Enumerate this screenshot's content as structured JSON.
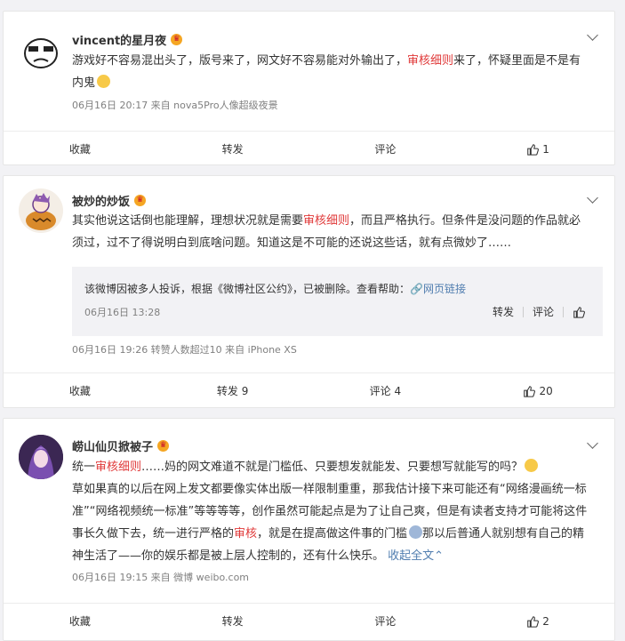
{
  "posts": [
    {
      "author": "vincent的星月夜",
      "text_parts": [
        "游戏好不容易混出头了，版号来了，网文好不容易能对外输出了，",
        "审核细则",
        "来了，怀疑里面是不是有内鬼"
      ],
      "meta": "06月16日 20:17  来自 nova5Pro人像超级夜景",
      "actions": {
        "collect": "收藏",
        "repost": "转发",
        "comment": "评论",
        "like": "1"
      }
    },
    {
      "author": "被炒的炒饭",
      "text_parts": [
        "其实他说这话倒也能理解，理想状况就是需要",
        "审核细则",
        "，而且严格执行。但条件是没问题的作品就必须过，过不了得说明白到底啥问题。知道这是不可能的还说这些话，就有点微妙了……"
      ],
      "repost": {
        "text": "该微博因被多人投诉，根据《微博社区公约》，已被删除。查看帮助：",
        "link": "网页链接",
        "time": "06月16日 13:28",
        "repost_label": "转发",
        "comment_label": "评论"
      },
      "meta": "06月16日 19:26 转赞人数超过10  来自 iPhone XS",
      "actions": {
        "collect": "收藏",
        "repost": "转发 9",
        "comment": "评论 4",
        "like": "20"
      }
    },
    {
      "author": "崂山仙贝掀被子",
      "text_parts": [
        "统一",
        "审核细则",
        "……妈的网文难道不就是门槛低、只要想发就能发、只要想写就能写的吗？",
        "草如果真的以后在网上发文都要像实体出版一样限制重重，那我估计接下来可能还有“网络漫画统一标准”“网络视频统一标准”等等等等，创作虽然可能起点是为了让自己爽，但是有读者支持才可能将这件事长久做下去，统一进行严格的",
        "审核",
        "，就是在提高做这件事的门槛",
        "那以后普通人就别想有自己的精神生活了——你的娱乐都是被上层人控制的，还有什么快乐。",
        "收起全文"
      ],
      "meta": "06月16日 19:15  来自 微博 weibo.com",
      "actions": {
        "collect": "收藏",
        "repost": "转发",
        "comment": "评论",
        "like": "2"
      }
    }
  ],
  "colors": {
    "keyword": "#e03939",
    "link": "#eb7350",
    "meta": "#808080"
  }
}
